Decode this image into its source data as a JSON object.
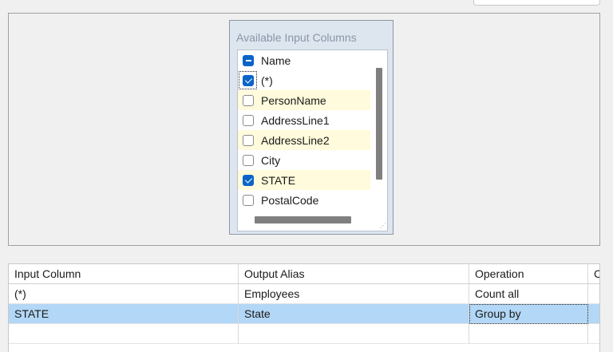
{
  "designer": {
    "table_title": "Available Input Columns",
    "columns": [
      {
        "label": "Name",
        "state": "partial",
        "highlight": false
      },
      {
        "label": "(*)",
        "state": "checked",
        "highlight": false
      },
      {
        "label": "PersonName",
        "state": "unchecked",
        "highlight": true
      },
      {
        "label": "AddressLine1",
        "state": "unchecked",
        "highlight": false
      },
      {
        "label": "AddressLine2",
        "state": "unchecked",
        "highlight": true
      },
      {
        "label": "City",
        "state": "unchecked",
        "highlight": false
      },
      {
        "label": "STATE",
        "state": "checked",
        "highlight": true
      },
      {
        "label": "PostalCode",
        "state": "unchecked",
        "highlight": false
      }
    ]
  },
  "grid": {
    "headers": [
      "Input Column",
      "Output Alias",
      "Operation",
      "C"
    ],
    "rows": [
      {
        "input_column": "(*)",
        "output_alias": "Employees",
        "operation": "Count all",
        "selected": false
      },
      {
        "input_column": "STATE",
        "output_alias": "State",
        "operation": "Group by",
        "selected": true
      }
    ]
  },
  "colors": {
    "checkbox_checked": "#0a64c8",
    "row_highlight": "#fffbdc",
    "selected_row": "#b3d7f6"
  }
}
